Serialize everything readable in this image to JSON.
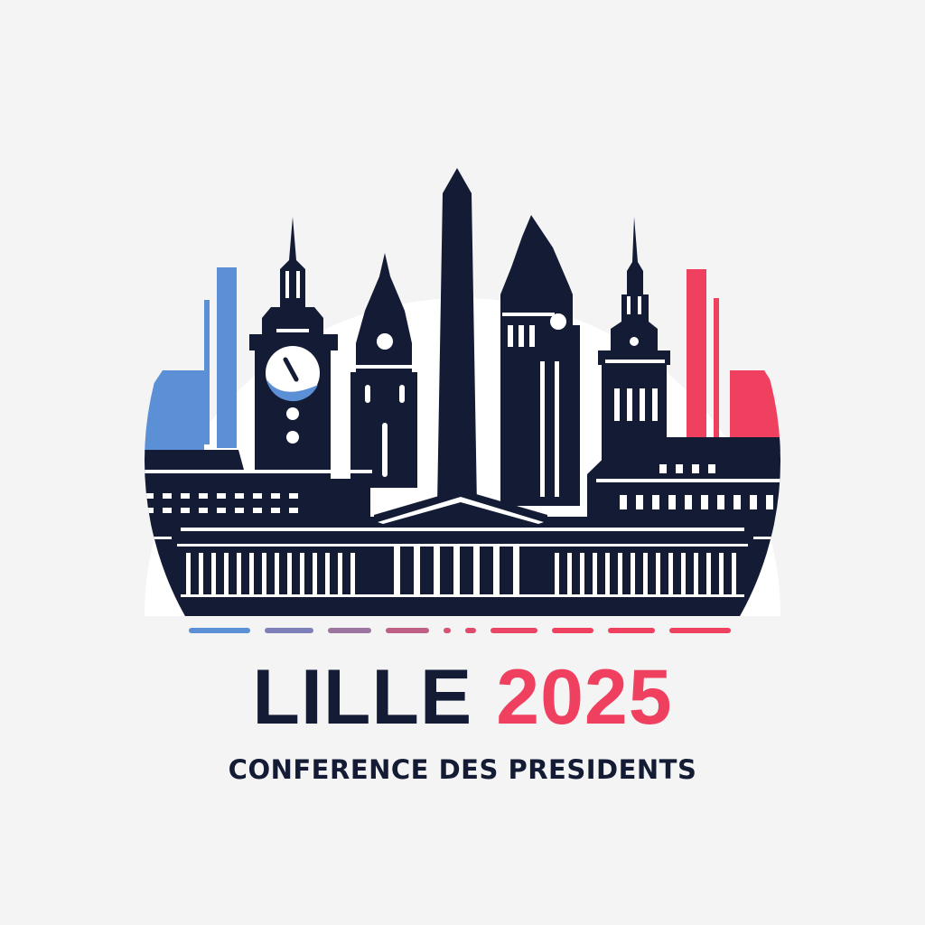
{
  "logo": {
    "city": "LILLE",
    "year": "2025",
    "tagline": "CONFERENCE DES PRESIDENTS"
  },
  "colors": {
    "navy": "#141b35",
    "blue": "#5b8fd6",
    "red": "#f0405f",
    "background": "#f4f4f4",
    "disc": "#ffffff"
  }
}
